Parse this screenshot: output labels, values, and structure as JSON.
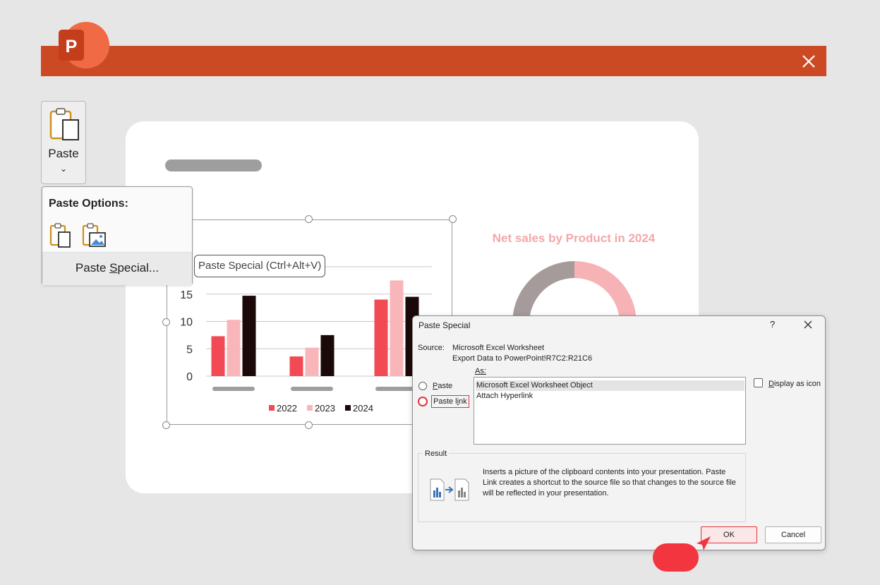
{
  "app": {
    "logo_letter": "P"
  },
  "ribbon": {
    "paste_label": "Paste",
    "paste_chevron": "⌄"
  },
  "paste_options": {
    "header": "Paste Options:",
    "paste_special_label": "Paste Special...",
    "paste_special_accesskey": "S"
  },
  "tooltip": {
    "text": "Paste Special (Ctrl+Alt+V)"
  },
  "colors": {
    "titlebar": "#cc4a23",
    "s2022": "#f24a54",
    "s2023": "#f9b6ba",
    "s2024": "#1b0909",
    "donut_gray": "#a59b9b",
    "donut_pink": "#f7b2b5",
    "accent_red": "#e3333a"
  },
  "chart_data": [
    {
      "type": "bar",
      "categories": [
        "",
        "",
        ""
      ],
      "series": [
        {
          "name": "2022",
          "values": [
            7.3,
            3.6,
            14.0
          ]
        },
        {
          "name": "2023",
          "values": [
            10.3,
            5.2,
            17.5
          ]
        },
        {
          "name": "2024",
          "values": [
            14.7,
            7.5,
            14.5
          ]
        }
      ],
      "yticks": [
        "0",
        "5",
        "10",
        "15"
      ],
      "ylim": [
        0,
        20
      ],
      "grid": true,
      "legend": "bottom"
    },
    {
      "type": "pie",
      "title": "Net sales by Product in 2024",
      "values": [
        50,
        50
      ],
      "colors": [
        "#f7b2b5",
        "#a59b9b"
      ]
    }
  ],
  "dialog": {
    "title": "Paste Special",
    "help": "?",
    "source_label": "Source:",
    "source_line1": "Microsoft Excel Worksheet",
    "source_line2": "Export Data to PowerPoint!R7C2:R21C6",
    "as_label": "As:",
    "radio_paste": "Paste",
    "radio_paste_link": "Paste link",
    "list_items": [
      "Microsoft Excel Worksheet Object",
      "Attach Hyperlink"
    ],
    "display_as_icon": "Display as icon",
    "result_label": "Result",
    "result_text": "Inserts a picture of the clipboard contents into your presentation. Paste Link creates a shortcut to the source file so that changes to the source file will be reflected in your presentation.",
    "ok": "OK",
    "cancel": "Cancel"
  }
}
